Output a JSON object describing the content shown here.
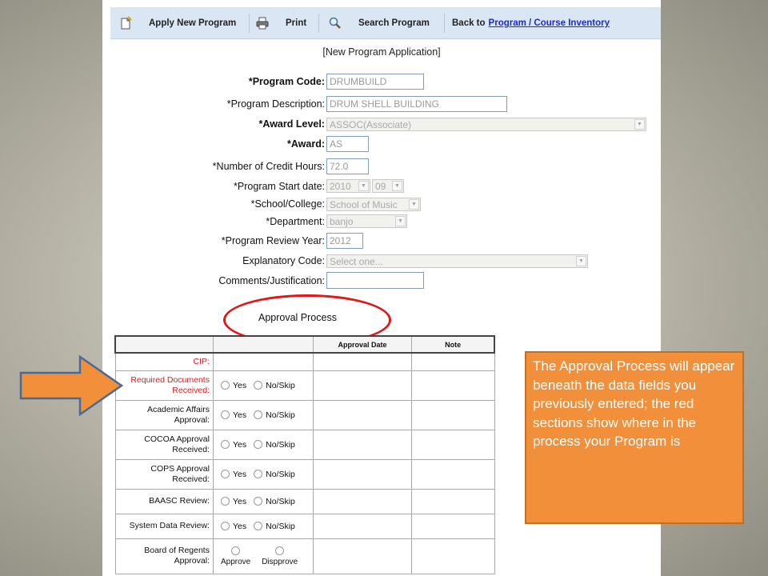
{
  "toolbar": {
    "apply_label": "Apply New Program",
    "print_label": "Print",
    "search_label": "Search Program",
    "back_label": "Back to",
    "back_link": "Program / Course Inventory"
  },
  "form": {
    "heading": "[New Program Application]",
    "program_code": {
      "label": "*Program Code:",
      "value": "DRUMBUILD"
    },
    "program_description": {
      "label": "*Program Description:",
      "value": "DRUM SHELL BUILDING"
    },
    "award_level": {
      "label": "*Award Level:",
      "value": "ASSOC(Associate)"
    },
    "award": {
      "label": "*Award:",
      "value": "AS"
    },
    "credit_hours": {
      "label": "*Number of Credit Hours:",
      "value": "72.0"
    },
    "start_date": {
      "label": "*Program Start date:",
      "year": "2010",
      "month": "09"
    },
    "school": {
      "label": "*School/College:",
      "value": "School of Music"
    },
    "department": {
      "label": "*Department:",
      "value": "banjo"
    },
    "review_year": {
      "label": "*Program Review Year:",
      "value": "2012"
    },
    "explanatory_code": {
      "label": "Explanatory Code:",
      "value": "Select one..."
    },
    "comments": {
      "label": "Comments/Justification:",
      "value": ""
    }
  },
  "approval": {
    "heading": "Approval Process",
    "columns": [
      "",
      "",
      "Approval Date",
      "Note"
    ],
    "yes_label": "Yes",
    "noskip_label": "No/Skip",
    "approve_label": "Approve",
    "disapprove_label": "Dispprove",
    "steps": [
      {
        "label": "CIP:",
        "highlight": true
      },
      {
        "label": "Required Documents Received:",
        "highlight": true
      },
      {
        "label": "Academic Affairs Approval:",
        "highlight": false
      },
      {
        "label": "COCOA Approval Received:",
        "highlight": false
      },
      {
        "label": "COPS Approval Received:",
        "highlight": false
      },
      {
        "label": "BAASC Review:",
        "highlight": false
      },
      {
        "label": "System Data Review:",
        "highlight": false
      },
      {
        "label": "Board of Regents Approval:",
        "highlight": false
      }
    ]
  },
  "callout": {
    "text": "The Approval Process will appear beneath the data fields you previously entered; the red sections show where in the process your Program is"
  },
  "colors": {
    "callout_fill": "#f18f3b",
    "highlight_red": "#e21b1b",
    "toolbar_bg": "#dbe6f4"
  }
}
